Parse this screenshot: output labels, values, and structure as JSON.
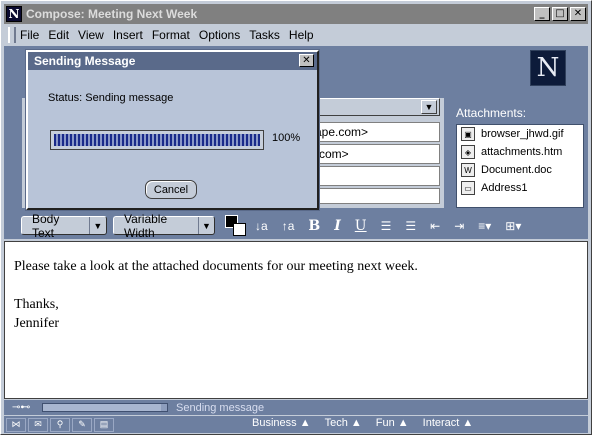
{
  "window": {
    "title": "Compose: Meeting Next Week",
    "min": "_",
    "max": "□",
    "close": "✕"
  },
  "menu": [
    "File",
    "Edit",
    "View",
    "Insert",
    "Format",
    "Options",
    "Tasks",
    "Help"
  ],
  "logo": "N",
  "addresses": [
    "cape.com>",
    "e.com>"
  ],
  "attachments": {
    "label": "Attachments:",
    "items": [
      {
        "name": "browser_jhwd.gif",
        "icon": "image-file-icon"
      },
      {
        "name": "attachments.htm",
        "icon": "html-file-icon"
      },
      {
        "name": "Document.doc",
        "icon": "word-doc-icon"
      },
      {
        "name": "Address1",
        "icon": "document-icon"
      }
    ]
  },
  "format": {
    "paragraph_style": "Body Text",
    "font": "Variable Width",
    "decrease_font": "↓a",
    "increase_font": "↑a",
    "bold": "B",
    "italic": "I",
    "underline": "U",
    "bullets": "☰",
    "numbers": "☰",
    "outdent": "⇤",
    "indent": "⇥",
    "align": "≡▾",
    "insert": "⊞▾"
  },
  "body": {
    "line1": "Please take a look at the attached documents for our meeting next week.",
    "line2": "Thanks,",
    "line3": "Jennifer"
  },
  "status": {
    "text": "Sending message",
    "progress": 0.95
  },
  "taskbar": {
    "tabs": [
      "Business ▲",
      "Tech ▲",
      "Fun ▲",
      "Interact ▲"
    ]
  },
  "dialog": {
    "title": "Sending Message",
    "status": "Status: Sending message",
    "percent_label": "100%",
    "progress": 1.0,
    "cancel": "Cancel",
    "close": "✕"
  }
}
